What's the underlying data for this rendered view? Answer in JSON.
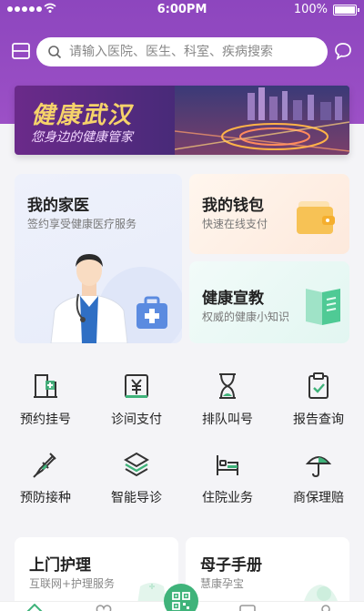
{
  "status_bar": {
    "time": "6:00PM",
    "battery": "100%"
  },
  "header": {
    "search_placeholder": "请输入医院、医生、科室、疾病搜索",
    "brand_color": "#8d46be"
  },
  "banner": {
    "title": "健康武汉",
    "subtitle": "您身边的健康管家"
  },
  "cards": {
    "family_doctor": {
      "title": "我的家医",
      "subtitle": "签约享受健康医疗服务"
    },
    "wallet": {
      "title": "我的钱包",
      "subtitle": "快速在线支付"
    },
    "health_edu": {
      "title": "健康宣教",
      "subtitle": "权威的健康小知识"
    }
  },
  "services": [
    {
      "label": "预约挂号",
      "icon": "hospital-booking-icon"
    },
    {
      "label": "诊间支付",
      "icon": "yuan-payment-icon"
    },
    {
      "label": "排队叫号",
      "icon": "hourglass-icon"
    },
    {
      "label": "报告查询",
      "icon": "clipboard-check-icon"
    },
    {
      "label": "预防接种",
      "icon": "syringe-icon"
    },
    {
      "label": "智能导诊",
      "icon": "layers-icon"
    },
    {
      "label": "住院业务",
      "icon": "bed-icon"
    },
    {
      "label": "商保理赔",
      "icon": "umbrella-icon"
    }
  ],
  "bottom_cards": [
    {
      "title": "上门护理",
      "subtitle": "互联网+护理服务"
    },
    {
      "title": "母子手册",
      "subtitle": "慧康孕宝"
    }
  ],
  "accent_green": "#3fb37a"
}
